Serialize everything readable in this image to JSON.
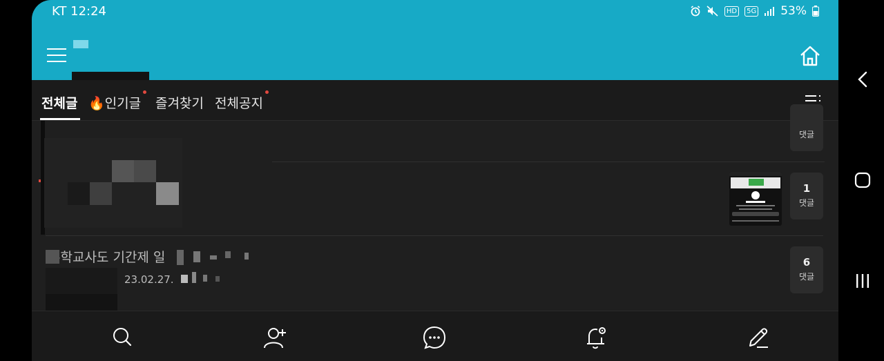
{
  "statusbar": {
    "carrier_time": "KT 12:24",
    "hd": "HD",
    "net": "5G",
    "battery": "53%"
  },
  "appbar": {
    "menu_icon": "hamburger-icon",
    "home_icon": "home-icon",
    "colors": {
      "bar": "#17aac6",
      "dark": "#1f1f1f"
    }
  },
  "tabs": [
    {
      "label": "전체글",
      "active": true,
      "new": false
    },
    {
      "label": "🔥인기글",
      "active": false,
      "new": true
    },
    {
      "label": "즐겨찾기",
      "active": false,
      "new": false
    },
    {
      "label": "전체공지",
      "active": false,
      "new": true
    }
  ],
  "posts": [
    {
      "comments": "",
      "comment_label": "댓글"
    },
    {
      "comments": "1",
      "comment_label": "댓글",
      "thumbnail": "video-thumbnail"
    },
    {
      "title": "수학교사도 기간제 일",
      "date": "23.02.27.",
      "comments": "6",
      "comment_label": "댓글"
    }
  ],
  "bottom_nav": [
    {
      "icon": "search-icon"
    },
    {
      "icon": "add-friend-icon"
    },
    {
      "icon": "chat-icon"
    },
    {
      "icon": "notification-settings-icon"
    },
    {
      "icon": "write-icon"
    }
  ]
}
